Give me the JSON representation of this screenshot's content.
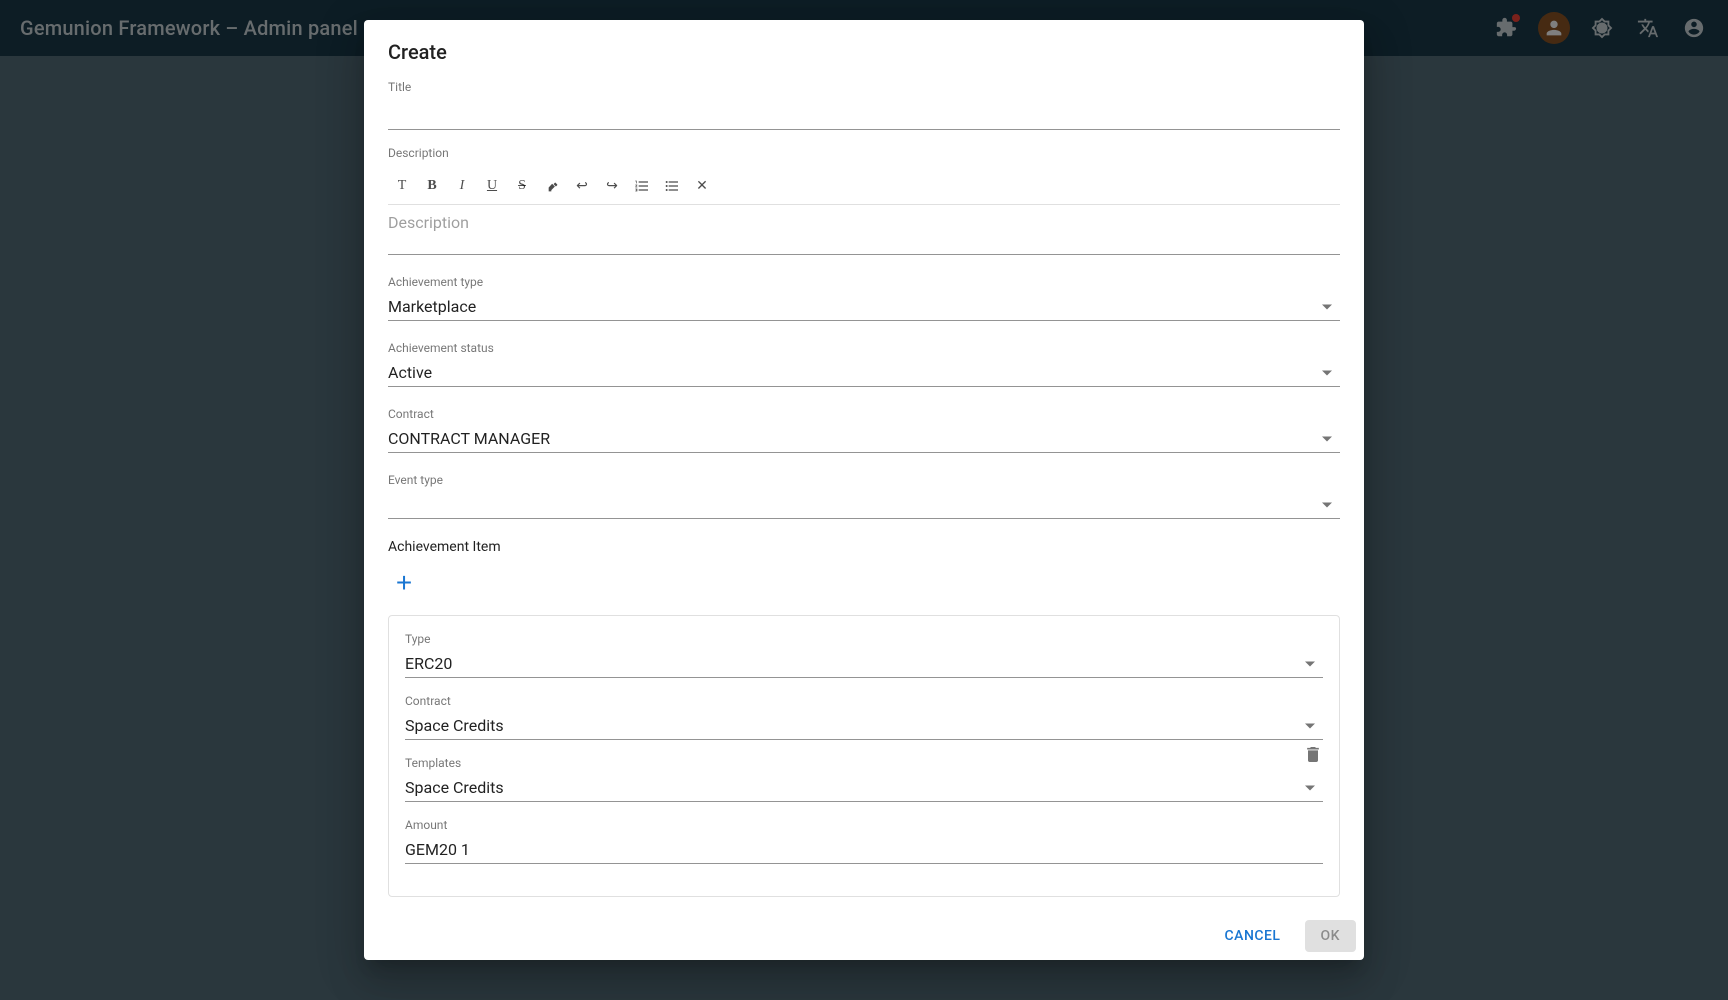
{
  "app": {
    "title": "Gemunion Framework – Admin panel"
  },
  "header": {
    "icons": [
      "puzzle-icon",
      "avatar-icon",
      "theme-icon",
      "language-icon",
      "settings-icon"
    ]
  },
  "dialog": {
    "title": "Create",
    "fields": {
      "title_label": "Title",
      "description_label": "Description",
      "description_placeholder": "Description",
      "achievement_type_label": "Achievement type",
      "achievement_type_value": "Marketplace",
      "achievement_status_label": "Achievement status",
      "achievement_status_value": "Active",
      "contract_label": "Contract",
      "contract_value": "CONTRACT MANAGER",
      "event_type_label": "Event type",
      "event_type_value": "",
      "achievement_item_label": "Achievement Item",
      "item_type_label": "Type",
      "item_type_value": "ERC20",
      "item_contract_label": "Contract",
      "item_contract_value": "Space Credits",
      "item_templates_label": "Templates",
      "item_templates_value": "Space Credits",
      "item_amount_label": "Amount",
      "item_amount_value": "GEM20 1"
    },
    "toolbar_buttons": [
      {
        "label": "T",
        "name": "text-button"
      },
      {
        "label": "B",
        "name": "bold-button"
      },
      {
        "label": "I",
        "name": "italic-button"
      },
      {
        "label": "U",
        "name": "underline-button"
      },
      {
        "label": "S",
        "name": "strikethrough-button"
      },
      {
        "label": "✎",
        "name": "highlight-button"
      },
      {
        "label": "↩",
        "name": "undo-button"
      },
      {
        "label": "↪",
        "name": "redo-button"
      },
      {
        "label": "≡",
        "name": "ordered-list-button"
      },
      {
        "label": "≡",
        "name": "unordered-list-button"
      },
      {
        "label": "✕",
        "name": "clear-format-button"
      }
    ],
    "actions": {
      "cancel_label": "CANCEL",
      "ok_label": "OK"
    }
  }
}
